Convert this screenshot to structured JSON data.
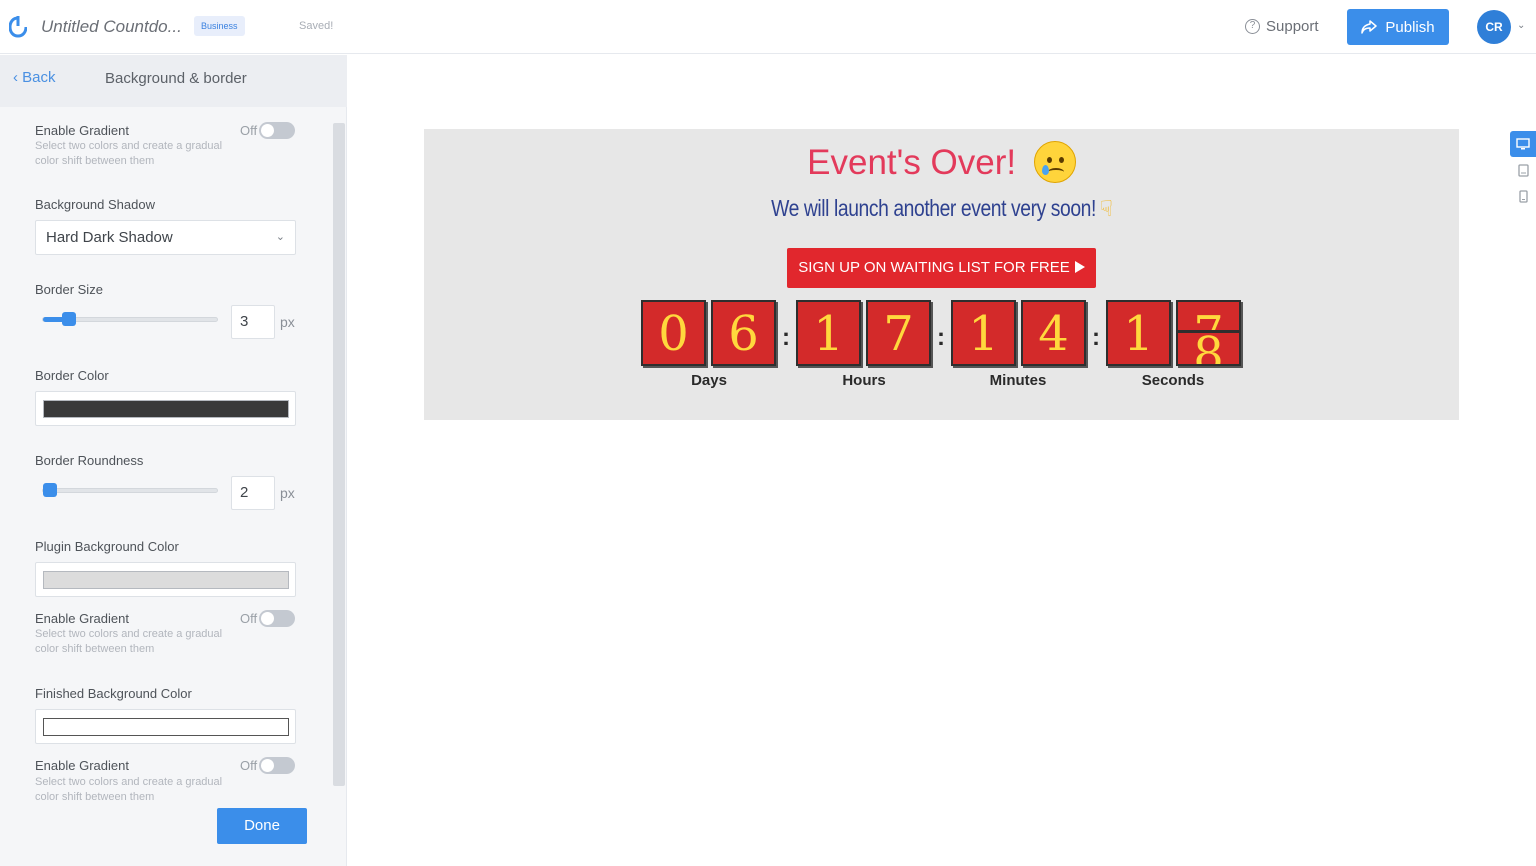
{
  "header": {
    "doc_title": "Untitled Countdo...",
    "plan_badge": "Business",
    "save_status": "Saved!",
    "support_label": "Support",
    "publish_label": "Publish",
    "avatar_initials": "CR"
  },
  "panel": {
    "back_label": "Back",
    "title": "Background & border",
    "gradient_1": {
      "label": "Enable Gradient",
      "hint": "Select two colors and create a gradual color shift between them",
      "state": "Off"
    },
    "shadow": {
      "label": "Background Shadow",
      "value": "Hard Dark Shadow"
    },
    "border_size": {
      "label": "Border Size",
      "value": "3",
      "unit": "px",
      "slider_fraction": 0.12
    },
    "border_color": {
      "label": "Border Color",
      "color": "#3a3a3a"
    },
    "border_roundness": {
      "label": "Border Roundness",
      "value": "2",
      "unit": "px",
      "slider_fraction": 0.02
    },
    "plugin_bg": {
      "label": "Plugin Background Color",
      "color": "#dcdcdc"
    },
    "gradient_2": {
      "label": "Enable Gradient",
      "hint": "Select two colors and create a gradual color shift between them",
      "state": "Off"
    },
    "finished_bg": {
      "label": "Finished Background Color",
      "color": "#ffffff"
    },
    "gradient_3": {
      "label": "Enable Gradient",
      "hint": "Select two colors and create a gradual color shift between them",
      "state": "Off"
    },
    "done_label": "Done"
  },
  "preview": {
    "headline": "Event's Over!",
    "subline": "We will launch another event very soon!",
    "cta_label": "SIGN UP ON WAITING LIST FOR FREE",
    "digits": {
      "d1": "0",
      "d2": "6",
      "h1": "1",
      "h2": "7",
      "m1": "1",
      "m2": "4",
      "s1": "1",
      "s2_top": "7",
      "s2_bottom": "8"
    },
    "units": {
      "days": "Days",
      "hours": "Hours",
      "minutes": "Minutes",
      "seconds": "Seconds"
    },
    "colon": ":"
  },
  "colors": {
    "accent": "#3b8eea",
    "headline": "#e33a5b",
    "subline": "#2f4290",
    "cta": "#e1272d",
    "digit_bg": "#d32a2a",
    "digit_text": "#ffd83d"
  },
  "icons": {
    "logo": "logo-icon",
    "support": "question-circle-icon",
    "publish": "share-icon",
    "sad_emoji": "crying-face-icon",
    "pointing": "pointing-down-icon",
    "desktop": "desktop-icon",
    "tablet": "tablet-icon",
    "mobile": "mobile-icon"
  }
}
